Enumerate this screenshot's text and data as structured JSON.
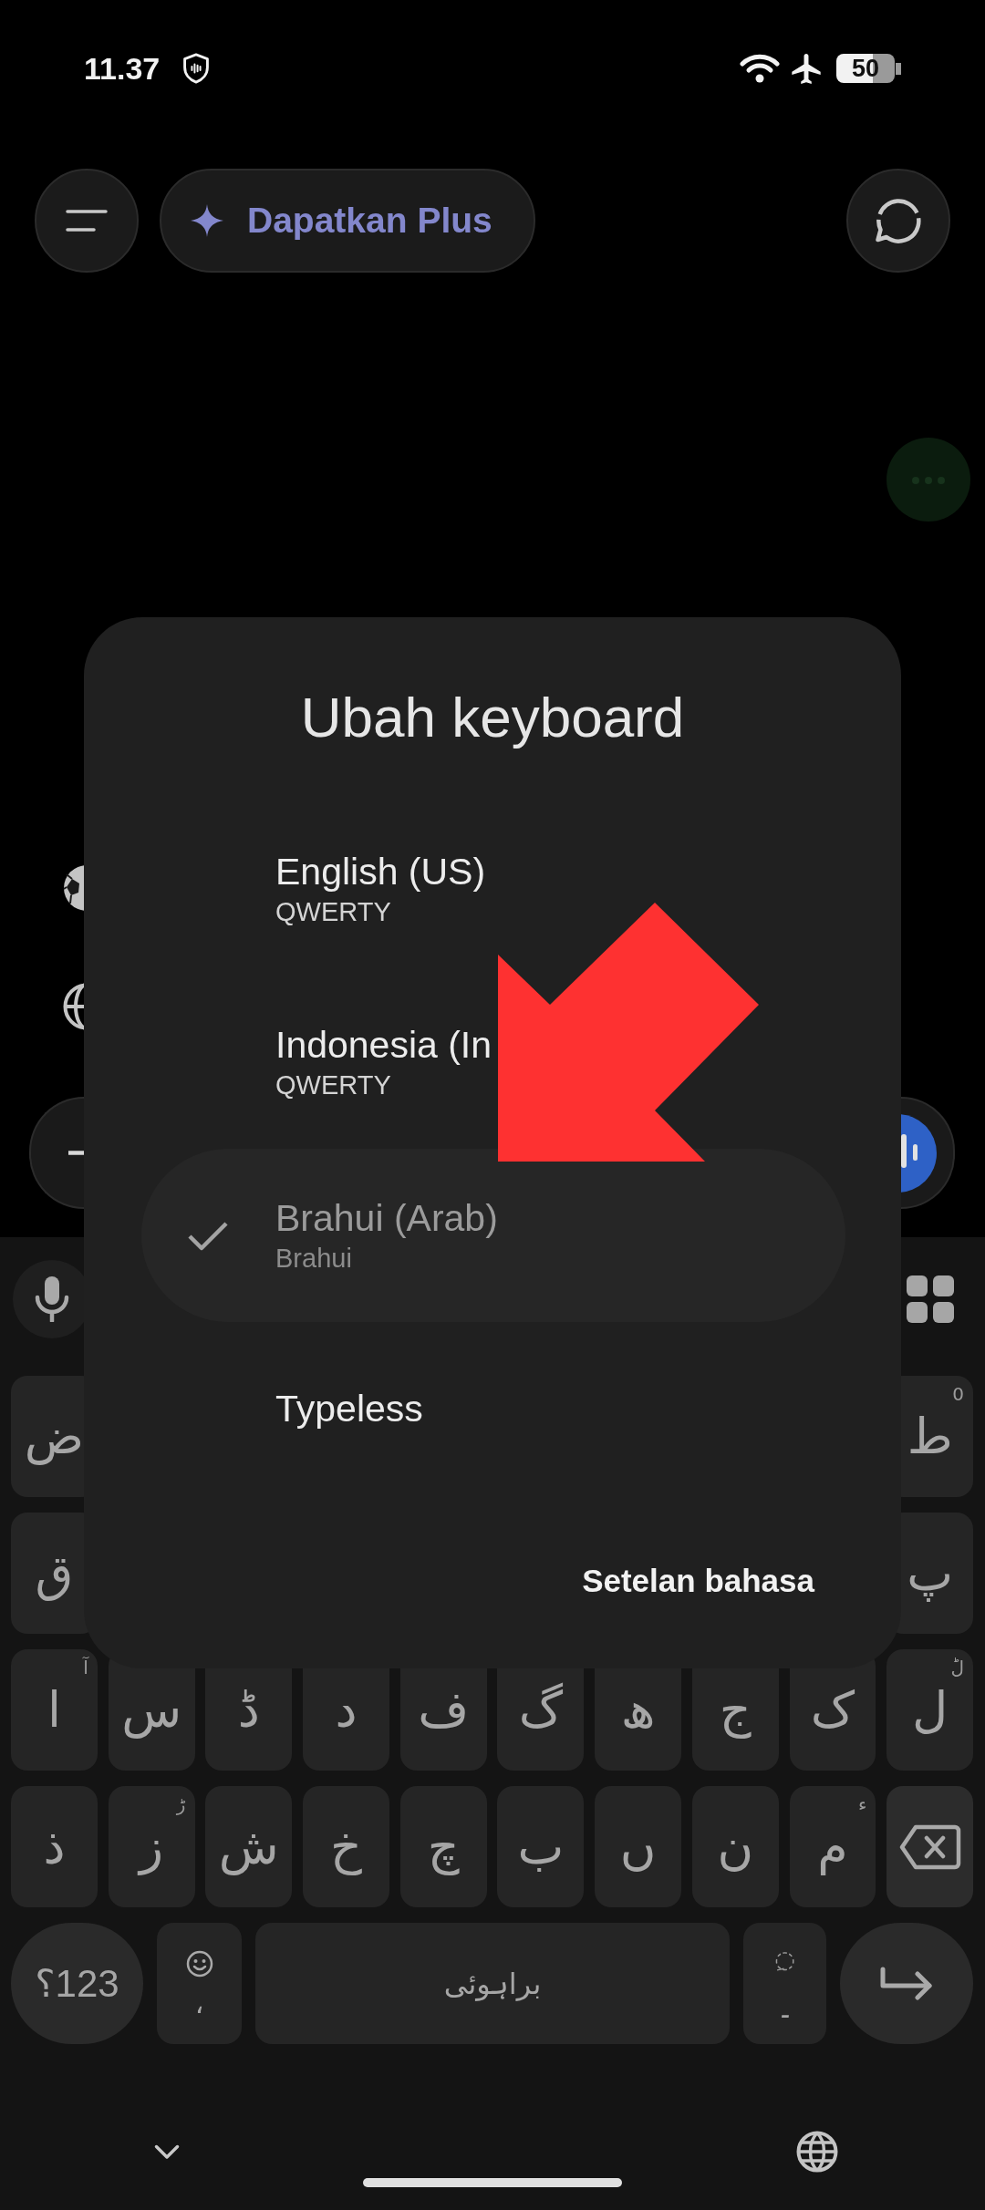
{
  "status_bar": {
    "time": "11.37",
    "battery": "50"
  },
  "top_bar": {
    "upgrade_button": "Dapatkan Plus"
  },
  "keyboard_dialog": {
    "title": "Ubah keyboard",
    "options": [
      {
        "label": "English (US)",
        "subtitle": "QWERTY",
        "selected": false
      },
      {
        "label": "Indonesia (In",
        "subtitle": "QWERTY",
        "selected": false
      },
      {
        "label": "Brahui (Arab)",
        "subtitle": "Brahui",
        "selected": true
      },
      {
        "label": "Typeless",
        "selected": false
      }
    ],
    "settings_link": "Setelan bahasa"
  },
  "keyboard": {
    "rows": [
      {
        "keys": [
          {
            "kind": "letter",
            "label": "ط",
            "hint": "0"
          },
          {
            "kind": "letter",
            "label": "ض"
          }
        ]
      },
      {
        "keys": [
          {
            "kind": "letter",
            "label": "پ"
          },
          {
            "kind": "letter",
            "label": "ق"
          }
        ]
      },
      {
        "keys": [
          {
            "kind": "letter",
            "label": "ل",
            "hint": "لؕ"
          },
          {
            "kind": "letter",
            "label": "ک"
          },
          {
            "kind": "letter",
            "label": "ج"
          },
          {
            "kind": "letter",
            "label": "ھ"
          },
          {
            "kind": "letter",
            "label": "گ"
          },
          {
            "kind": "letter",
            "label": "ف"
          },
          {
            "kind": "letter",
            "label": "د"
          },
          {
            "kind": "letter",
            "label": "ڈ"
          },
          {
            "kind": "letter",
            "label": "س"
          },
          {
            "kind": "letter",
            "label": "ا",
            "hint": "آ"
          }
        ]
      },
      {
        "keys": [
          {
            "kind": "backspace"
          },
          {
            "kind": "letter",
            "label": "م",
            "hint": "ء"
          },
          {
            "kind": "letter",
            "label": "ن"
          },
          {
            "kind": "letter",
            "label": "ں"
          },
          {
            "kind": "letter",
            "label": "ب"
          },
          {
            "kind": "letter",
            "label": "چ"
          },
          {
            "kind": "letter",
            "label": "خ"
          },
          {
            "kind": "letter",
            "label": "ش"
          },
          {
            "kind": "letter",
            "label": "ز",
            "hint": "ڑ"
          },
          {
            "kind": "letter",
            "label": "ذ"
          }
        ]
      }
    ],
    "bottom_row": [
      {
        "kind": "enter"
      },
      {
        "kind": "punct",
        "hint": "◌ِ",
        "label": "۔"
      },
      {
        "kind": "space",
        "label": "براہوئی"
      },
      {
        "kind": "emoji_comma",
        "label": "،"
      },
      {
        "kind": "symbols",
        "label": "؟123"
      }
    ]
  }
}
